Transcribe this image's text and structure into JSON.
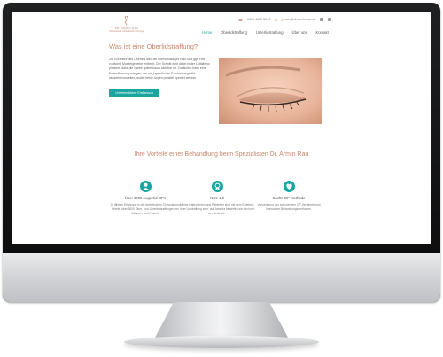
{
  "site": {
    "logo": {
      "line1": "DR. ARMIN RAU",
      "line2": "Plastische & Ästhetische Chirurgie"
    },
    "topbar": {
      "phone": "040 / 4656 5044",
      "email": "praxis@dr-armin-rau.de"
    },
    "nav": [
      {
        "label": "Home",
        "active": true
      },
      {
        "label": "Oberlidstraffung",
        "active": false
      },
      {
        "label": "Unterlidstraffung",
        "active": false
      },
      {
        "label": "Über uns",
        "active": false
      },
      {
        "label": "Kontakt",
        "active": false
      }
    ]
  },
  "hero": {
    "title": "Was ist eine Oberlidstraffung?",
    "text": "Zur Korrektur des Oberlids wird bei überschüssiger Haut und ggf. Fett zunächst Muskelgewebe entfernt. Der Schnitt wird dabei in der Lidfalte so platziert, dass die Narbe später kaum sichtbar ist. Zusätzlich kann eine Fettentfernung erfolgen, um ein jugendliches Erscheinungsbild wiederherzustellen, wobei beide Augen parallel operiert werden.",
    "cta_label": "Unverbindlicher Erstbesuch"
  },
  "benefits": {
    "title": "Ihre Vorteile einer Behandlung beim Spezialisten Dr. Armin Rau",
    "items": [
      {
        "icon": "person-icon",
        "title": "Über 3000 Augenlid-OPs",
        "text": "20 jährige Erfahrung in der ästhetischen Chirurgie und bereits über 3000 Ober- und Unterlidstraffungen bei Männern und Frauen."
      },
      {
        "icon": "award-icon",
        "title": "Note 1,0",
        "text": "Meine Patientinnen und Patienten sind mit dem Ergebnis ihrer Lidstraffung sehr, auf Jameda bewerten sie mich mit der Bestnote."
      },
      {
        "icon": "heart-icon",
        "title": "Sanfte OP-Methode",
        "text": "Verwendung von schonenden OP-Verfahren und innovativer Behandlungsmethoden."
      }
    ]
  },
  "colors": {
    "accent": "#19a6a0",
    "heading": "#c9876a",
    "frame": "#151516"
  }
}
